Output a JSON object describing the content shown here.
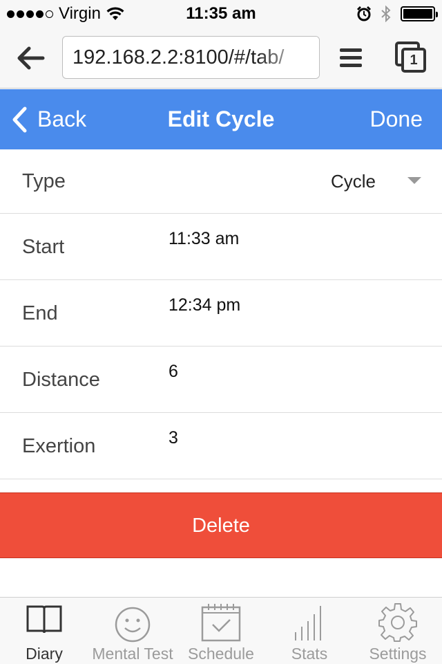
{
  "status_bar": {
    "carrier": "Virgin",
    "time": "11:35 am",
    "signal_bars_filled": 4,
    "signal_bars_total": 5
  },
  "browser": {
    "url": "192.168.2.2:8100/#/tab/",
    "tab_count": "1"
  },
  "header": {
    "back_label": "Back",
    "title": "Edit Cycle",
    "done_label": "Done",
    "color": "#4a8bec"
  },
  "form": {
    "type": {
      "label": "Type",
      "value": "Cycle"
    },
    "start": {
      "label": "Start",
      "value": "11:33 am"
    },
    "end": {
      "label": "End",
      "value": "12:34 pm"
    },
    "distance": {
      "label": "Distance",
      "value": "6"
    },
    "exertion": {
      "label": "Exertion",
      "value": "3"
    }
  },
  "delete_button": {
    "label": "Delete",
    "color": "#ef4e3a"
  },
  "tab_bar": {
    "active": "diary",
    "items": [
      {
        "id": "diary",
        "label": "Diary",
        "icon": "book-icon"
      },
      {
        "id": "mental",
        "label": "Mental Test",
        "icon": "smiley-icon"
      },
      {
        "id": "schedule",
        "label": "Schedule",
        "icon": "calendar-check-icon"
      },
      {
        "id": "stats",
        "label": "Stats",
        "icon": "bar-chart-icon"
      },
      {
        "id": "settings",
        "label": "Settings",
        "icon": "gear-icon"
      }
    ]
  }
}
